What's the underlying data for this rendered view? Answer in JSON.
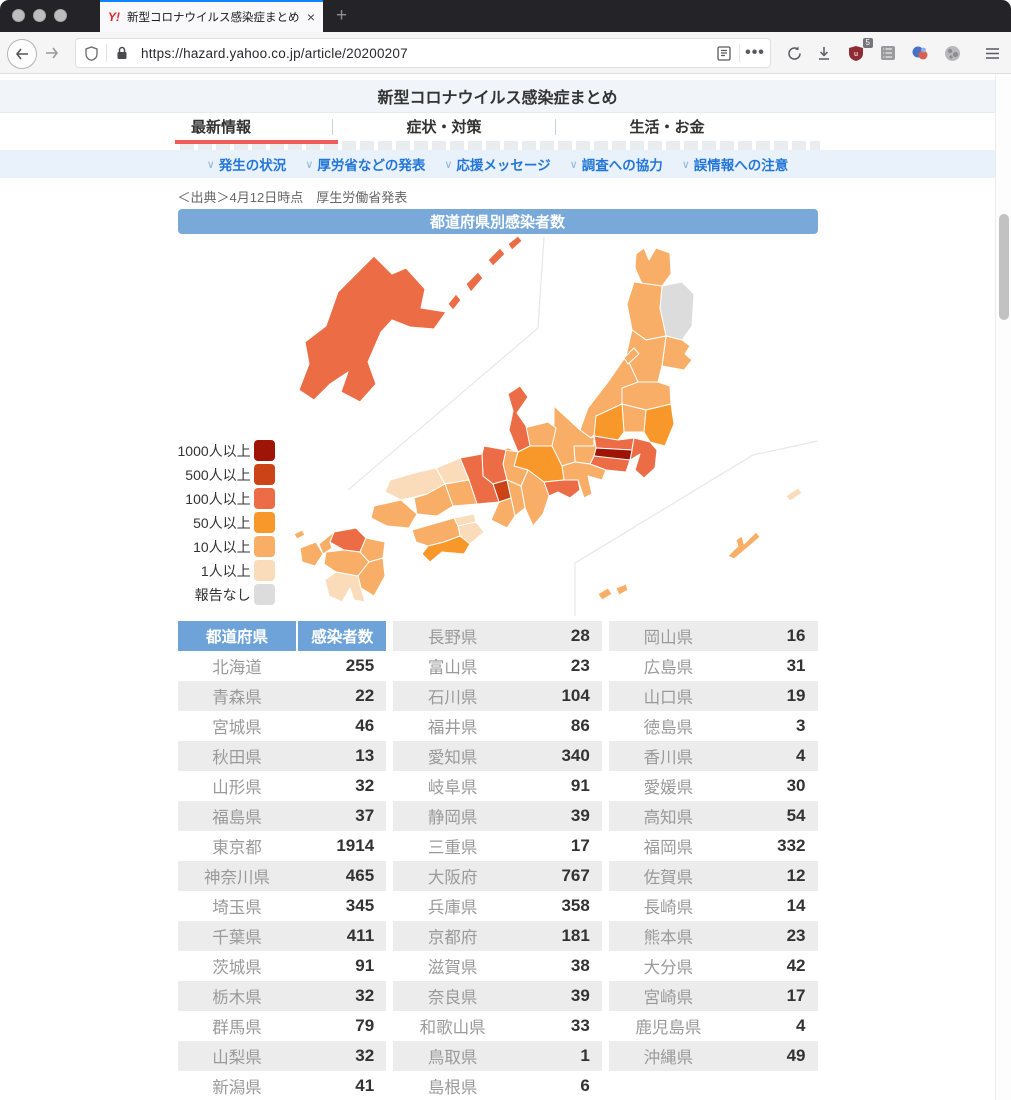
{
  "browser": {
    "tab": {
      "favicon": "Y!",
      "title": "新型コロナウイルス感染症まとめ",
      "close": "×"
    },
    "new_tab": "+",
    "url": "https://hazard.yahoo.co.jp/article/20200207",
    "shield_badge_count": "5"
  },
  "header": {
    "title": "新型コロナウイルス感染症まとめ"
  },
  "nav": {
    "tabs": [
      {
        "label": "最新情報",
        "active": true
      },
      {
        "label": "症状・対策",
        "active": false
      },
      {
        "label": "生活・お金",
        "active": false
      }
    ]
  },
  "subnav": {
    "chevron": "∨",
    "items": [
      {
        "label": "発生の状況"
      },
      {
        "label": "厚労省などの発表"
      },
      {
        "label": "応援メッセージ"
      },
      {
        "label": "調査への協力"
      },
      {
        "label": "誤情報への注意"
      }
    ]
  },
  "article": {
    "source_note": "＜出典＞4月12日時点　厚生労働省発表",
    "banner": "都道府県別感染者数"
  },
  "legend": [
    {
      "label": "1000人以上",
      "bucket": "b1000"
    },
    {
      "label": "500人以上",
      "bucket": "b500"
    },
    {
      "label": "100人以上",
      "bucket": "b100"
    },
    {
      "label": "50人以上",
      "bucket": "b50"
    },
    {
      "label": "10人以上",
      "bucket": "b10"
    },
    {
      "label": "1人以上",
      "bucket": "b1"
    },
    {
      "label": "報告なし",
      "bucket": "none"
    }
  ],
  "bucket_colors": {
    "b1000": "#9e1508",
    "b500": "#cb4317",
    "b100": "#ec6c45",
    "b50": "#f8982a",
    "b10": "#f9ae67",
    "b1": "#fbdcba",
    "none": "#dcdcdc"
  },
  "map": {
    "prefectures": {
      "hokkaido": {
        "name": "北海道",
        "value": 255,
        "bucket": "b100"
      },
      "aomori": {
        "name": "青森県",
        "value": 22,
        "bucket": "b10"
      },
      "iwate": {
        "name": "岩手県",
        "value": null,
        "bucket": "none"
      },
      "miyagi": {
        "name": "宮城県",
        "value": 46,
        "bucket": "b10"
      },
      "akita": {
        "name": "秋田県",
        "value": 13,
        "bucket": "b10"
      },
      "yamagata": {
        "name": "山形県",
        "value": 32,
        "bucket": "b10"
      },
      "fukushima": {
        "name": "福島県",
        "value": 37,
        "bucket": "b10"
      },
      "tokyo": {
        "name": "東京都",
        "value": 1914,
        "bucket": "b1000"
      },
      "kanagawa": {
        "name": "神奈川県",
        "value": 465,
        "bucket": "b100"
      },
      "saitama": {
        "name": "埼玉県",
        "value": 345,
        "bucket": "b100"
      },
      "chiba": {
        "name": "千葉県",
        "value": 411,
        "bucket": "b100"
      },
      "ibaraki": {
        "name": "茨城県",
        "value": 91,
        "bucket": "b50"
      },
      "tochigi": {
        "name": "栃木県",
        "value": 32,
        "bucket": "b10"
      },
      "gunma": {
        "name": "群馬県",
        "value": 79,
        "bucket": "b50"
      },
      "yamanashi": {
        "name": "山梨県",
        "value": 32,
        "bucket": "b10"
      },
      "niigata": {
        "name": "新潟県",
        "value": 41,
        "bucket": "b10"
      },
      "nagano": {
        "name": "長野県",
        "value": 28,
        "bucket": "b10"
      },
      "toyama": {
        "name": "富山県",
        "value": 23,
        "bucket": "b10"
      },
      "ishikawa": {
        "name": "石川県",
        "value": 104,
        "bucket": "b100"
      },
      "fukui": {
        "name": "福井県",
        "value": 86,
        "bucket": "b50"
      },
      "aichi": {
        "name": "愛知県",
        "value": 340,
        "bucket": "b100"
      },
      "gifu": {
        "name": "岐阜県",
        "value": 91,
        "bucket": "b50"
      },
      "shizuoka": {
        "name": "静岡県",
        "value": 39,
        "bucket": "b10"
      },
      "mie": {
        "name": "三重県",
        "value": 17,
        "bucket": "b10"
      },
      "osaka": {
        "name": "大阪府",
        "value": 767,
        "bucket": "b500"
      },
      "hyogo": {
        "name": "兵庫県",
        "value": 358,
        "bucket": "b100"
      },
      "kyoto": {
        "name": "京都府",
        "value": 181,
        "bucket": "b100"
      },
      "shiga": {
        "name": "滋賀県",
        "value": 38,
        "bucket": "b10"
      },
      "nara": {
        "name": "奈良県",
        "value": 39,
        "bucket": "b10"
      },
      "wakayama": {
        "name": "和歌山県",
        "value": 33,
        "bucket": "b10"
      },
      "tottori": {
        "name": "鳥取県",
        "value": 1,
        "bucket": "b1"
      },
      "shimane": {
        "name": "島根県",
        "value": 6,
        "bucket": "b1"
      },
      "okayama": {
        "name": "岡山県",
        "value": 16,
        "bucket": "b10"
      },
      "hiroshima": {
        "name": "広島県",
        "value": 31,
        "bucket": "b10"
      },
      "yamaguchi": {
        "name": "山口県",
        "value": 19,
        "bucket": "b10"
      },
      "tokushima": {
        "name": "徳島県",
        "value": 3,
        "bucket": "b1"
      },
      "kagawa": {
        "name": "香川県",
        "value": 4,
        "bucket": "b1"
      },
      "ehime": {
        "name": "愛媛県",
        "value": 30,
        "bucket": "b10"
      },
      "kochi": {
        "name": "高知県",
        "value": 54,
        "bucket": "b50"
      },
      "fukuoka": {
        "name": "福岡県",
        "value": 332,
        "bucket": "b100"
      },
      "saga": {
        "name": "佐賀県",
        "value": 12,
        "bucket": "b10"
      },
      "nagasaki": {
        "name": "長崎県",
        "value": 14,
        "bucket": "b10"
      },
      "kumamoto": {
        "name": "熊本県",
        "value": 23,
        "bucket": "b10"
      },
      "oita": {
        "name": "大分県",
        "value": 42,
        "bucket": "b10"
      },
      "miyazaki": {
        "name": "宮崎県",
        "value": 17,
        "bucket": "b10"
      },
      "kagoshima": {
        "name": "鹿児島県",
        "value": 4,
        "bucket": "b1"
      },
      "okinawa": {
        "name": "沖縄県",
        "value": 49,
        "bucket": "b10"
      }
    }
  },
  "table": {
    "headers": [
      "都道府県",
      "感染者数"
    ],
    "columns": [
      [
        {
          "name": "北海道",
          "value": "255"
        },
        {
          "name": "青森県",
          "value": "22"
        },
        {
          "name": "宮城県",
          "value": "46"
        },
        {
          "name": "秋田県",
          "value": "13"
        },
        {
          "name": "山形県",
          "value": "32"
        },
        {
          "name": "福島県",
          "value": "37"
        },
        {
          "name": "東京都",
          "value": "1914"
        },
        {
          "name": "神奈川県",
          "value": "465"
        },
        {
          "name": "埼玉県",
          "value": "345"
        },
        {
          "name": "千葉県",
          "value": "411"
        },
        {
          "name": "茨城県",
          "value": "91"
        },
        {
          "name": "栃木県",
          "value": "32"
        },
        {
          "name": "群馬県",
          "value": "79"
        },
        {
          "name": "山梨県",
          "value": "32"
        },
        {
          "name": "新潟県",
          "value": "41"
        }
      ],
      [
        {
          "name": "長野県",
          "value": "28"
        },
        {
          "name": "富山県",
          "value": "23"
        },
        {
          "name": "石川県",
          "value": "104"
        },
        {
          "name": "福井県",
          "value": "86"
        },
        {
          "name": "愛知県",
          "value": "340"
        },
        {
          "name": "岐阜県",
          "value": "91"
        },
        {
          "name": "静岡県",
          "value": "39"
        },
        {
          "name": "三重県",
          "value": "17"
        },
        {
          "name": "大阪府",
          "value": "767"
        },
        {
          "name": "兵庫県",
          "value": "358"
        },
        {
          "name": "京都府",
          "value": "181"
        },
        {
          "name": "滋賀県",
          "value": "38"
        },
        {
          "name": "奈良県",
          "value": "39"
        },
        {
          "name": "和歌山県",
          "value": "33"
        },
        {
          "name": "鳥取県",
          "value": "1"
        },
        {
          "name": "島根県",
          "value": "6"
        }
      ],
      [
        {
          "name": "岡山県",
          "value": "16"
        },
        {
          "name": "広島県",
          "value": "31"
        },
        {
          "name": "山口県",
          "value": "19"
        },
        {
          "name": "徳島県",
          "value": "3"
        },
        {
          "name": "香川県",
          "value": "4"
        },
        {
          "name": "愛媛県",
          "value": "30"
        },
        {
          "name": "高知県",
          "value": "54"
        },
        {
          "name": "福岡県",
          "value": "332"
        },
        {
          "name": "佐賀県",
          "value": "12"
        },
        {
          "name": "長崎県",
          "value": "14"
        },
        {
          "name": "熊本県",
          "value": "23"
        },
        {
          "name": "大分県",
          "value": "42"
        },
        {
          "name": "宮崎県",
          "value": "17"
        },
        {
          "name": "鹿児島県",
          "value": "4"
        },
        {
          "name": "沖縄県",
          "value": "49"
        }
      ]
    ]
  },
  "chart_data": {
    "type": "heatmap",
    "subtype": "choropleth-japan-prefecture-map",
    "title": "都道府県別感染者数",
    "source": "＜出典＞4月12日時点　厚生労働省発表",
    "unit": "人",
    "legend_buckets": [
      "1000人以上",
      "500人以上",
      "100人以上",
      "50人以上",
      "10人以上",
      "1人以上",
      "報告なし"
    ],
    "values": {
      "北海道": 255,
      "青森県": 22,
      "岩手県": null,
      "宮城県": 46,
      "秋田県": 13,
      "山形県": 32,
      "福島県": 37,
      "東京都": 1914,
      "神奈川県": 465,
      "埼玉県": 345,
      "千葉県": 411,
      "茨城県": 91,
      "栃木県": 32,
      "群馬県": 79,
      "山梨県": 32,
      "新潟県": 41,
      "長野県": 28,
      "富山県": 23,
      "石川県": 104,
      "福井県": 86,
      "愛知県": 340,
      "岐阜県": 91,
      "静岡県": 39,
      "三重県": 17,
      "大阪府": 767,
      "兵庫県": 358,
      "京都府": 181,
      "滋賀県": 38,
      "奈良県": 39,
      "和歌山県": 33,
      "鳥取県": 1,
      "島根県": 6,
      "岡山県": 16,
      "広島県": 31,
      "山口県": 19,
      "徳島県": 3,
      "香川県": 4,
      "愛媛県": 30,
      "高知県": 54,
      "福岡県": 332,
      "佐賀県": 12,
      "長崎県": 14,
      "熊本県": 23,
      "大分県": 42,
      "宮崎県": 17,
      "鹿児島県": 4,
      "沖縄県": 49
    }
  }
}
